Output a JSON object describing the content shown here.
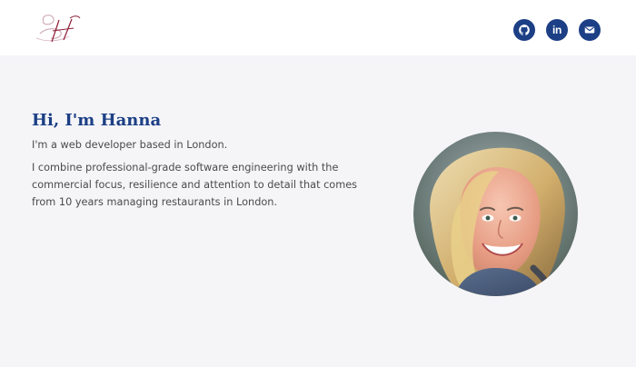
{
  "header": {
    "logo_icon": "hm-monogram-logo",
    "social": [
      {
        "name": "GitHub",
        "icon": "github-icon"
      },
      {
        "name": "LinkedIn",
        "icon": "linkedin-icon",
        "label": "in"
      },
      {
        "name": "Email",
        "icon": "email-icon"
      }
    ]
  },
  "hero": {
    "title": "Hi, I'm Hanna",
    "lead": "I'm a web developer based in London.",
    "body": "I combine professional-grade software engineering with the commercial focus, resilience and attention to detail that comes from 10 years managing restaurants in London.",
    "photo_icon": "profile-photo"
  },
  "colors": {
    "accent": "#1c3f85",
    "background": "#f5f5f8",
    "header_bg": "#ffffff",
    "text": "#4a4a4a"
  }
}
